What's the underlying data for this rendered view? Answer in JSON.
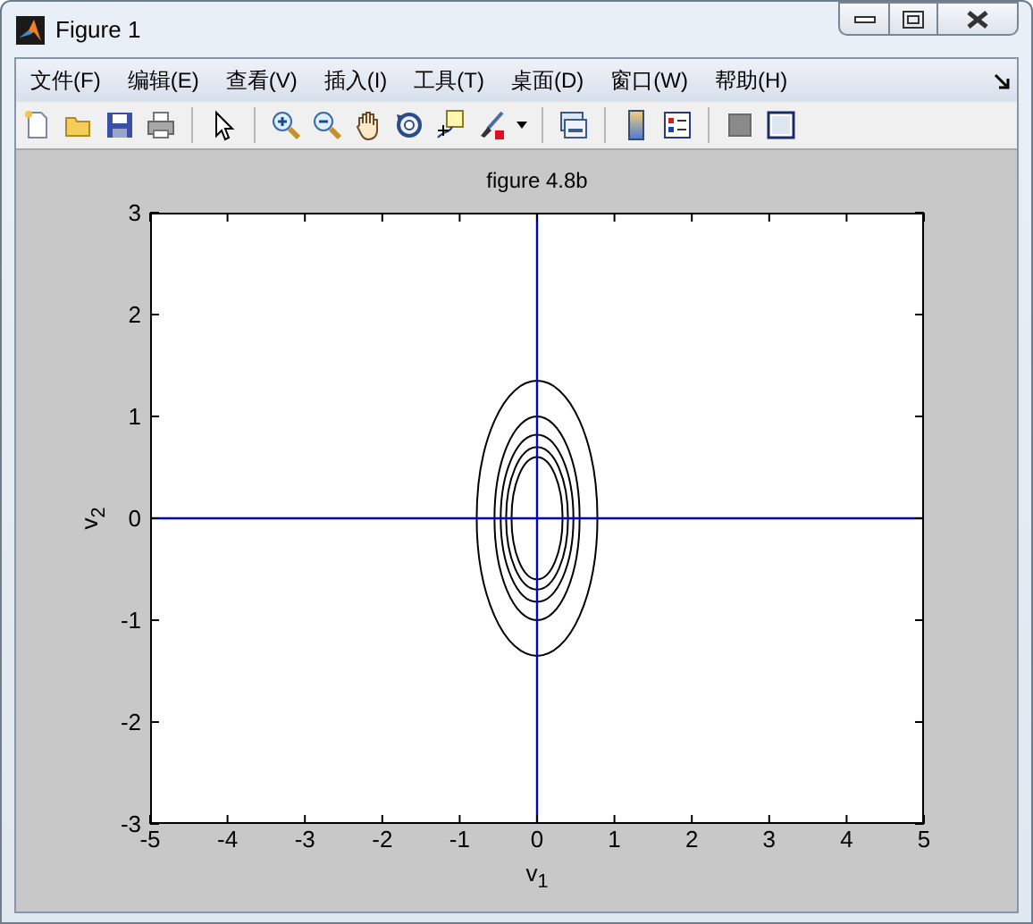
{
  "window": {
    "title": "Figure 1"
  },
  "menu": [
    "文件(F)",
    "编辑(E)",
    "查看(V)",
    "插入(I)",
    "工具(T)",
    "桌面(D)",
    "窗口(W)",
    "帮助(H)"
  ],
  "plot": {
    "chart_data": {
      "type": "line",
      "title": "figure 4.8b",
      "xlabel": "v$_{1}$",
      "ylabel": "v$_{2}$",
      "xlim": [
        -5,
        5
      ],
      "ylim": [
        -3,
        3
      ],
      "xticks": [
        -5,
        -4,
        -3,
        -2,
        -1,
        0,
        1,
        2,
        3,
        4,
        5
      ],
      "yticks": [
        -3,
        -2,
        -1,
        0,
        1,
        2,
        3
      ]
    }
  }
}
